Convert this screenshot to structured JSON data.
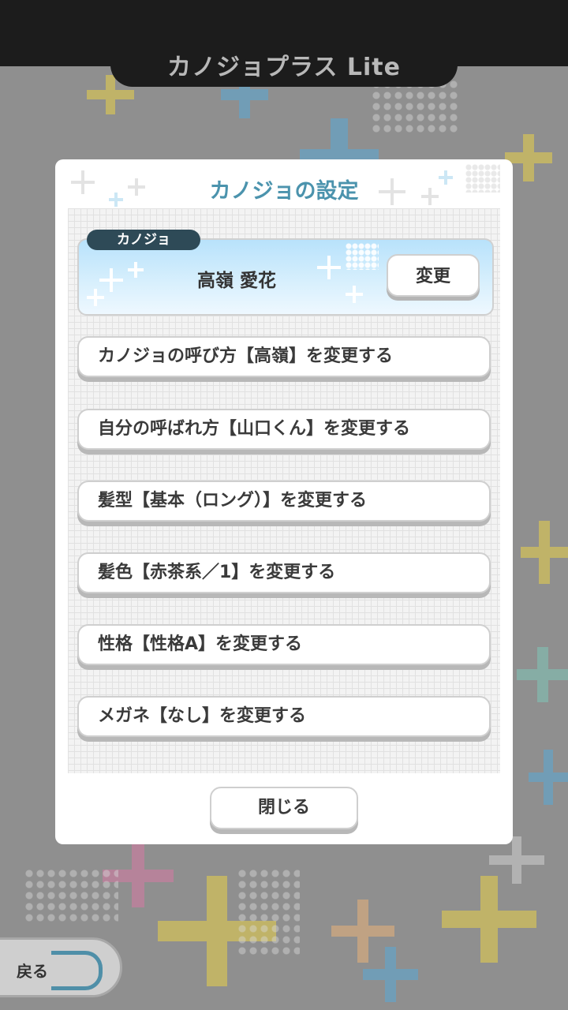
{
  "app": {
    "title": "カノジョプラス Lite"
  },
  "dialog": {
    "title": "カノジョの設定",
    "kanojo": {
      "label": "カノジョ",
      "name": "高嶺 愛花",
      "change_button": "変更"
    },
    "options": [
      "カノジョの呼び方【高嶺】を変更する",
      "自分の呼ばれ方【山口くん】を変更する",
      "髪型【基本（ロング）】を変更する",
      "髪色【赤茶系／1】を変更する",
      "性格【性格A】を変更する",
      "メガネ【なし】を変更する"
    ],
    "close_button": "閉じる"
  },
  "footer": {
    "back_label": "戻る"
  },
  "colors": {
    "accent": "#4b93ad",
    "header": "#1c1c1c",
    "label_bg": "#2e4a57"
  }
}
